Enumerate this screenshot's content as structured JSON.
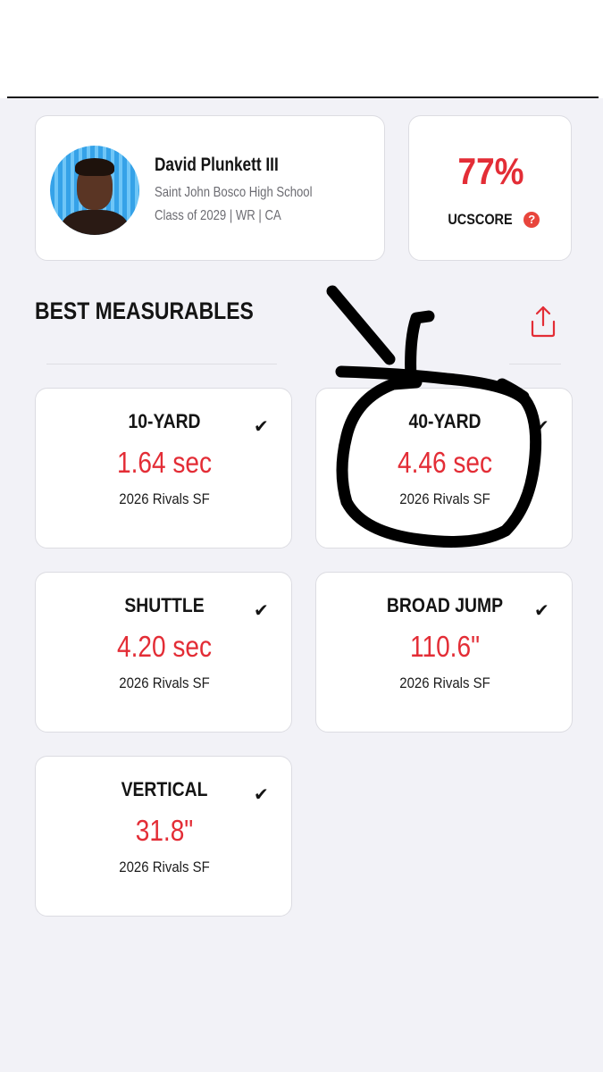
{
  "profile": {
    "name": "David Plunkett III",
    "school": "Saint John Bosco High School",
    "class_line": "Class of 2029 | WR | CA"
  },
  "score": {
    "value": "77%",
    "label": "UCSCORE",
    "help_glyph": "?"
  },
  "section": {
    "title": "BEST MEASURABLES",
    "share_icon": "share-icon"
  },
  "measurables": [
    {
      "name": "10-YARD",
      "value": "1.64 sec",
      "event": "2026 Rivals SF",
      "check": "✔"
    },
    {
      "name": "40-YARD",
      "value": "4.46 sec",
      "event": "2026 Rivals SF",
      "check": "✔"
    },
    {
      "name": "SHUTTLE",
      "value": "4.20 sec",
      "event": "2026 Rivals SF",
      "check": "✔"
    },
    {
      "name": "BROAD JUMP",
      "value": "110.6\"",
      "event": "2026 Rivals SF",
      "check": "✔"
    },
    {
      "name": "VERTICAL",
      "value": "31.8\"",
      "event": "2026 Rivals SF",
      "check": "✔"
    }
  ],
  "colors": {
    "accent_red": "#e32d36",
    "background": "#f2f2f7",
    "card": "#ffffff",
    "annotation_ink": "#000000"
  }
}
